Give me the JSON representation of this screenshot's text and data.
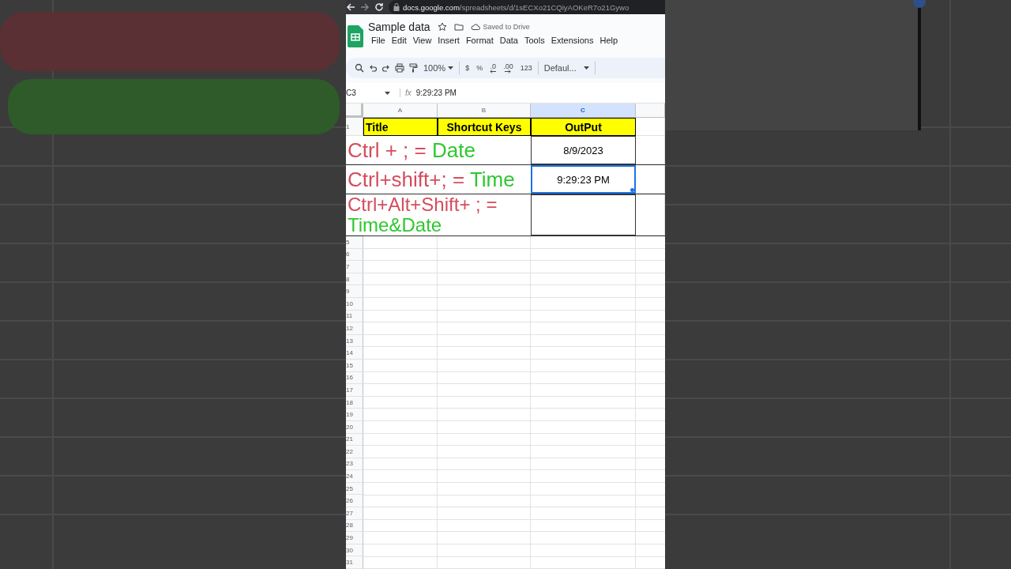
{
  "browser": {
    "url_host": "docs.google.com",
    "url_path": "/spreadsheets/d/1sECXo21CQiyAOKeR7o21Gywo"
  },
  "document": {
    "title": "Sample data",
    "save_status": "Saved to Drive"
  },
  "menu": [
    "File",
    "Edit",
    "View",
    "Insert",
    "Format",
    "Data",
    "Tools",
    "Extensions",
    "Help"
  ],
  "toolbar": {
    "zoom": "100%",
    "currency": "$",
    "percent": "%",
    "decrease_decimals": ".0",
    "increase_decimals": ".00",
    "number_format": "123",
    "font": "Defaul..."
  },
  "formula_bar": {
    "cell_ref": "C3",
    "fx_label": "fx",
    "value": "9:29:23 PM"
  },
  "columns": [
    {
      "label": "A",
      "selected": false
    },
    {
      "label": "B",
      "selected": false
    },
    {
      "label": "C",
      "selected": true
    }
  ],
  "rows": [
    {
      "kind": "heading",
      "number": "1",
      "cells": [
        {
          "value": "Title",
          "selected": false
        },
        {
          "value": "Shortcut Keys",
          "selected": false
        },
        {
          "value": "OutPut",
          "selected": false
        }
      ]
    },
    {
      "kind": "shortcut",
      "keys": "Ctrl + ; =",
      "result": "Date",
      "wrapped": false,
      "cells": [
        {
          "value": "8/9/2023",
          "selected": false
        }
      ]
    },
    {
      "kind": "shortcut",
      "keys": "Ctrl+shift+; =",
      "result": "Time",
      "wrapped": false,
      "cells": [
        {
          "value": "9:29:23 PM",
          "selected": true
        }
      ]
    },
    {
      "kind": "shortcut",
      "keys": "Ctrl+Alt+Shift+ ; =",
      "result": "Time&Date",
      "wrapped": true,
      "cells": [
        {
          "selected": false
        }
      ]
    }
  ],
  "empty_rows": [
    "5",
    "6",
    "7",
    "8",
    "9",
    "10",
    "11",
    "12",
    "13",
    "14",
    "15",
    "16",
    "17",
    "18",
    "19",
    "20",
    "21",
    "22",
    "23",
    "24",
    "25",
    "26",
    "27",
    "28",
    "29",
    "30",
    "31"
  ]
}
